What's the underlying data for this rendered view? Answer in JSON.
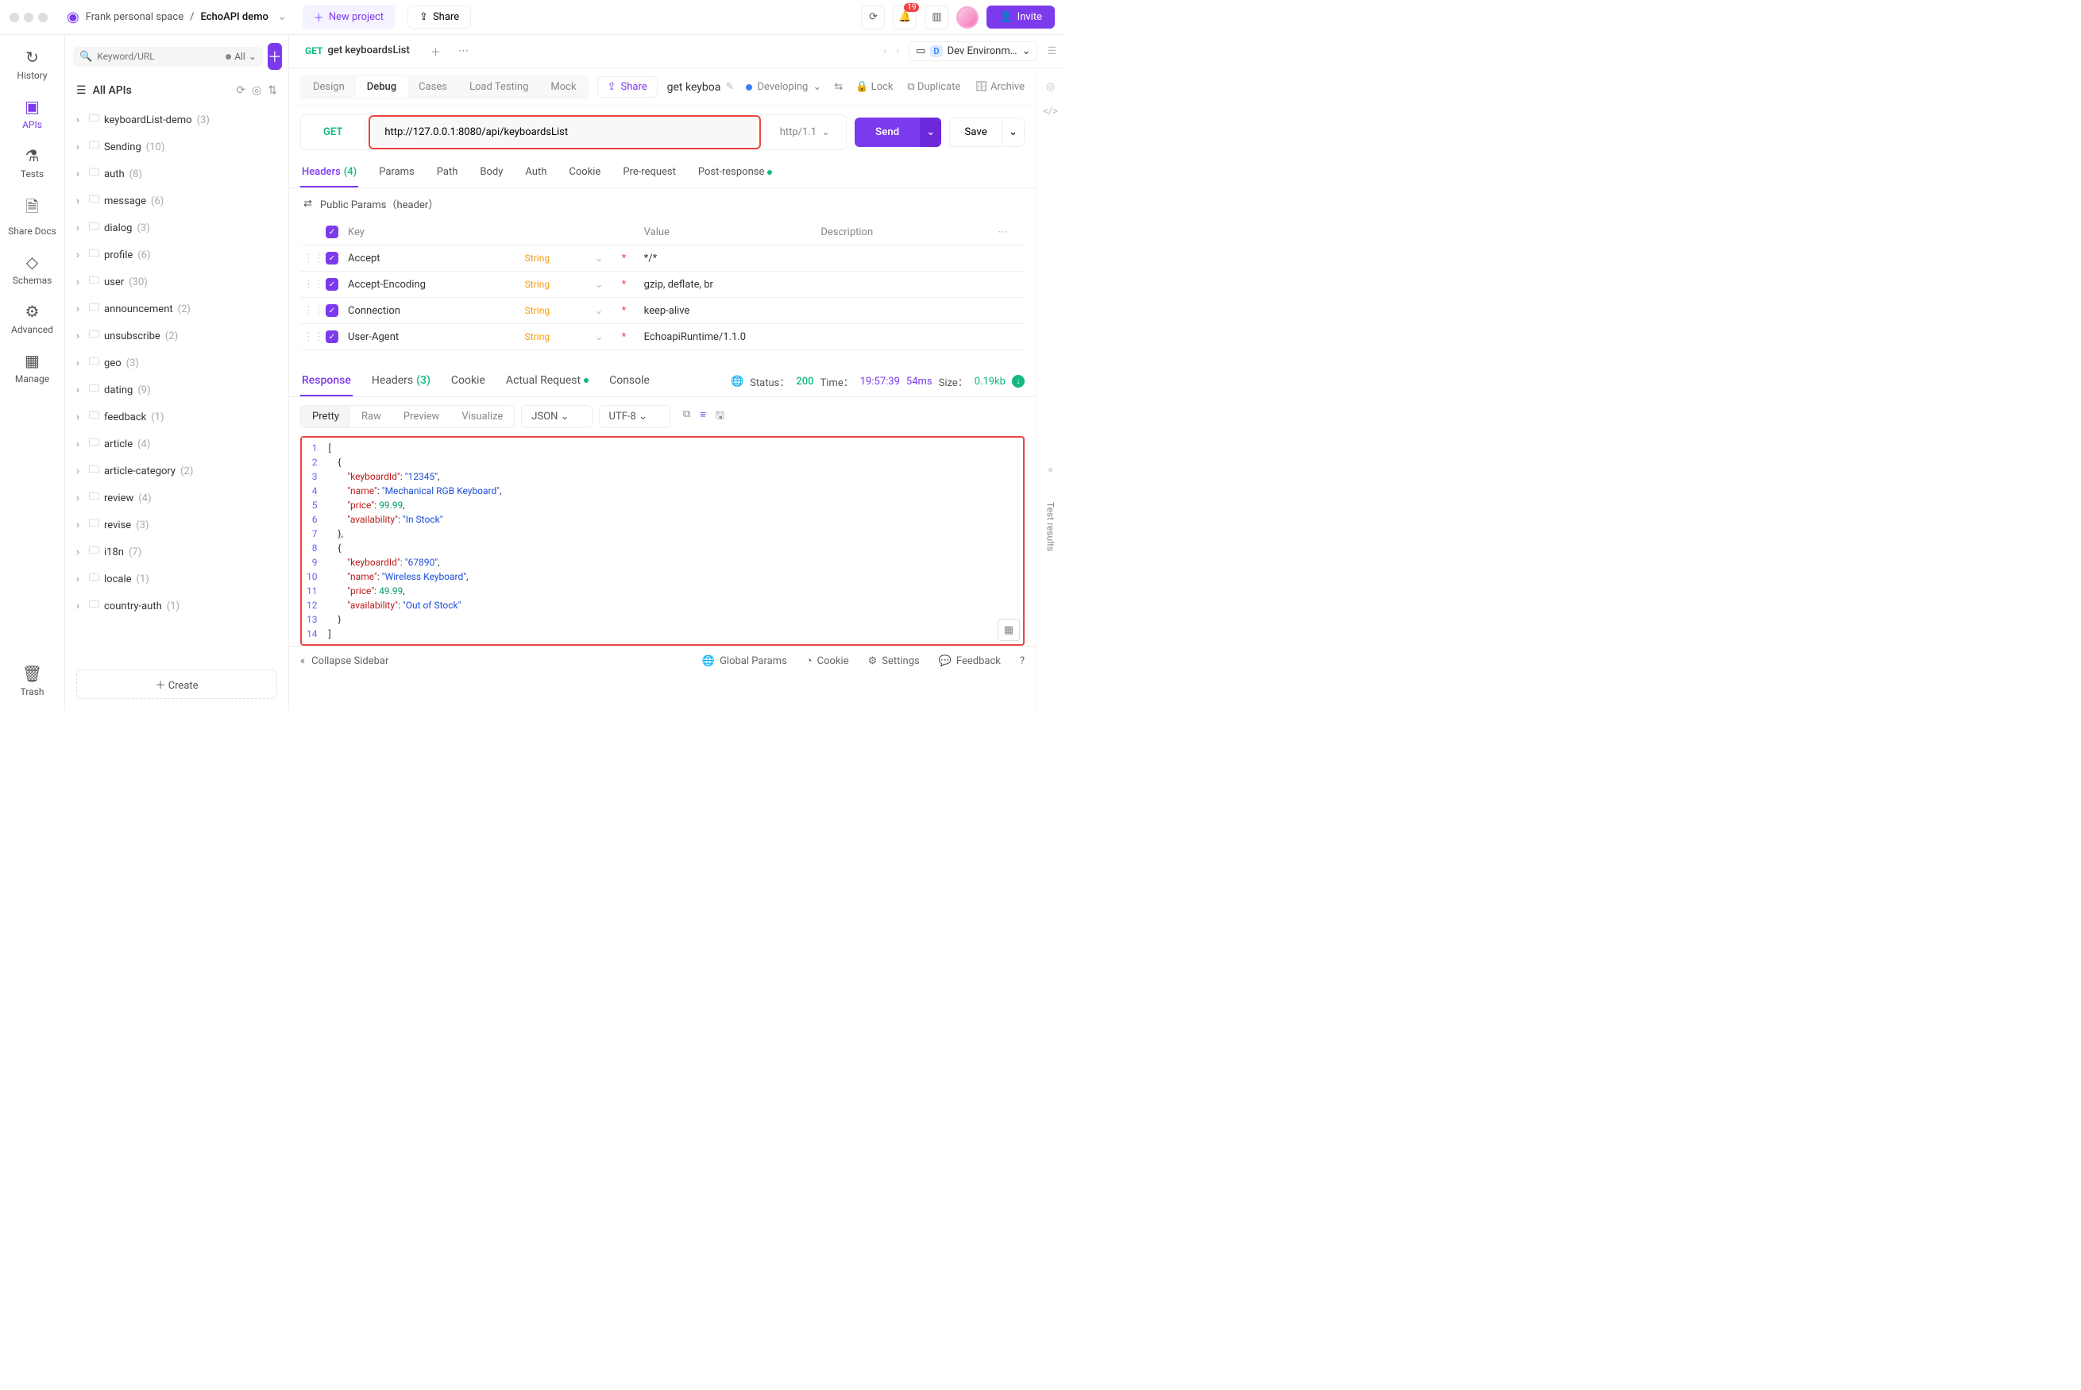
{
  "title_bar": {
    "workspace": "Frank personal space",
    "project": "EchoAPI demo",
    "new_project": "New project",
    "share": "Share",
    "notif_count": "19",
    "invite": "Invite"
  },
  "left_rail": [
    {
      "label": "History"
    },
    {
      "label": "APIs"
    },
    {
      "label": "Tests"
    },
    {
      "label": "Share Docs"
    },
    {
      "label": "Schemas"
    },
    {
      "label": "Advanced"
    },
    {
      "label": "Manage"
    }
  ],
  "trash": "Trash",
  "sidebar": {
    "search_placeholder": "Keyword/URL",
    "filter_all": "All",
    "all_apis": "All APIs",
    "items": [
      {
        "name": "keyboardList-demo",
        "count": "(3)"
      },
      {
        "name": "Sending",
        "count": "(10)"
      },
      {
        "name": "auth",
        "count": "(8)"
      },
      {
        "name": "message",
        "count": "(6)"
      },
      {
        "name": "dialog",
        "count": "(3)"
      },
      {
        "name": "profile",
        "count": "(6)"
      },
      {
        "name": "user",
        "count": "(30)"
      },
      {
        "name": "announcement",
        "count": "(2)"
      },
      {
        "name": "unsubscribe",
        "count": "(2)"
      },
      {
        "name": "geo",
        "count": "(3)"
      },
      {
        "name": "dating",
        "count": "(9)"
      },
      {
        "name": "feedback",
        "count": "(1)"
      },
      {
        "name": "article",
        "count": "(4)"
      },
      {
        "name": "article-category",
        "count": "(2)"
      },
      {
        "name": "review",
        "count": "(4)"
      },
      {
        "name": "revise",
        "count": "(3)"
      },
      {
        "name": "i18n",
        "count": "(7)"
      },
      {
        "name": "locale",
        "count": "(1)"
      },
      {
        "name": "country-auth",
        "count": "(1)"
      }
    ],
    "create": "Create"
  },
  "tab": {
    "method": "GET",
    "title": "get keyboardsList"
  },
  "env": {
    "badge": "D",
    "label": "Dev Environm…"
  },
  "views": {
    "design": "Design",
    "debug": "Debug",
    "cases": "Cases",
    "load": "Load Testing",
    "mock": "Mock"
  },
  "share_btn": "Share",
  "api_name": "get keyboa",
  "status_label": "Developing",
  "actions": {
    "lock": "Lock",
    "duplicate": "Duplicate",
    "archive": "Archive"
  },
  "request": {
    "method": "GET",
    "url": "http://127.0.0.1:8080/api/keyboardsList",
    "protocol": "http/1.1",
    "send": "Send",
    "save": "Save"
  },
  "req_tabs": {
    "headers": "Headers",
    "headers_count": "(4)",
    "params": "Params",
    "path": "Path",
    "body": "Body",
    "auth": "Auth",
    "cookie": "Cookie",
    "pre": "Pre-request",
    "post": "Post-response"
  },
  "public_section": "Public Params（header）",
  "hheader": {
    "key": "Key",
    "value": "Value",
    "desc": "Description"
  },
  "headers_rows": [
    {
      "key": "Accept",
      "type": "String",
      "value": "*/*"
    },
    {
      "key": "Accept-Encoding",
      "type": "String",
      "value": "gzip, deflate, br"
    },
    {
      "key": "Connection",
      "type": "String",
      "value": "keep-alive"
    },
    {
      "key": "User-Agent",
      "type": "String",
      "value": "EchoapiRuntime/1.1.0"
    }
  ],
  "resp_tabs": {
    "response": "Response",
    "headers": "Headers",
    "hcount": "(3)",
    "cookie": "Cookie",
    "actual": "Actual Request",
    "console": "Console"
  },
  "resp_status": {
    "status_label": "Status：",
    "code": "200",
    "time_label": "Time：",
    "time": "19:57:39",
    "latency": "54ms",
    "size_label": "Size：",
    "size": "0.19kb"
  },
  "resp_views": {
    "pretty": "Pretty",
    "raw": "Raw",
    "preview": "Preview",
    "visualize": "Visualize"
  },
  "resp_format": "JSON",
  "resp_charset": "UTF-8",
  "code_lines": [
    [
      {
        "t": "punc",
        "v": "["
      }
    ],
    [
      {
        "t": "punc",
        "v": "    {"
      }
    ],
    [
      {
        "t": "punc",
        "v": "        "
      },
      {
        "t": "key",
        "v": "\"keyboardId\""
      },
      {
        "t": "punc",
        "v": ": "
      },
      {
        "t": "str",
        "v": "\"12345\""
      },
      {
        "t": "punc",
        "v": ","
      }
    ],
    [
      {
        "t": "punc",
        "v": "        "
      },
      {
        "t": "key",
        "v": "\"name\""
      },
      {
        "t": "punc",
        "v": ": "
      },
      {
        "t": "str",
        "v": "\"Mechanical RGB Keyboard\""
      },
      {
        "t": "punc",
        "v": ","
      }
    ],
    [
      {
        "t": "punc",
        "v": "        "
      },
      {
        "t": "key",
        "v": "\"price\""
      },
      {
        "t": "punc",
        "v": ": "
      },
      {
        "t": "num",
        "v": "99.99"
      },
      {
        "t": "punc",
        "v": ","
      }
    ],
    [
      {
        "t": "punc",
        "v": "        "
      },
      {
        "t": "key",
        "v": "\"availability\""
      },
      {
        "t": "punc",
        "v": ": "
      },
      {
        "t": "str",
        "v": "\"In Stock\""
      }
    ],
    [
      {
        "t": "punc",
        "v": "    },"
      }
    ],
    [
      {
        "t": "punc",
        "v": "    {"
      }
    ],
    [
      {
        "t": "punc",
        "v": "        "
      },
      {
        "t": "key",
        "v": "\"keyboardId\""
      },
      {
        "t": "punc",
        "v": ": "
      },
      {
        "t": "str",
        "v": "\"67890\""
      },
      {
        "t": "punc",
        "v": ","
      }
    ],
    [
      {
        "t": "punc",
        "v": "        "
      },
      {
        "t": "key",
        "v": "\"name\""
      },
      {
        "t": "punc",
        "v": ": "
      },
      {
        "t": "str",
        "v": "\"Wireless Keyboard\""
      },
      {
        "t": "punc",
        "v": ","
      }
    ],
    [
      {
        "t": "punc",
        "v": "        "
      },
      {
        "t": "key",
        "v": "\"price\""
      },
      {
        "t": "punc",
        "v": ": "
      },
      {
        "t": "num",
        "v": "49.99"
      },
      {
        "t": "punc",
        "v": ","
      }
    ],
    [
      {
        "t": "punc",
        "v": "        "
      },
      {
        "t": "key",
        "v": "\"availability\""
      },
      {
        "t": "punc",
        "v": ": "
      },
      {
        "t": "str",
        "v": "\"Out of Stock\""
      }
    ],
    [
      {
        "t": "punc",
        "v": "    }"
      }
    ],
    [
      {
        "t": "punc",
        "v": "]"
      }
    ]
  ],
  "collapse": "Collapse Sidebar",
  "bottom": {
    "gp": "Global Params",
    "cookie": "Cookie",
    "settings": "Settings",
    "feedback": "Feedback"
  },
  "test_results": "Test results"
}
